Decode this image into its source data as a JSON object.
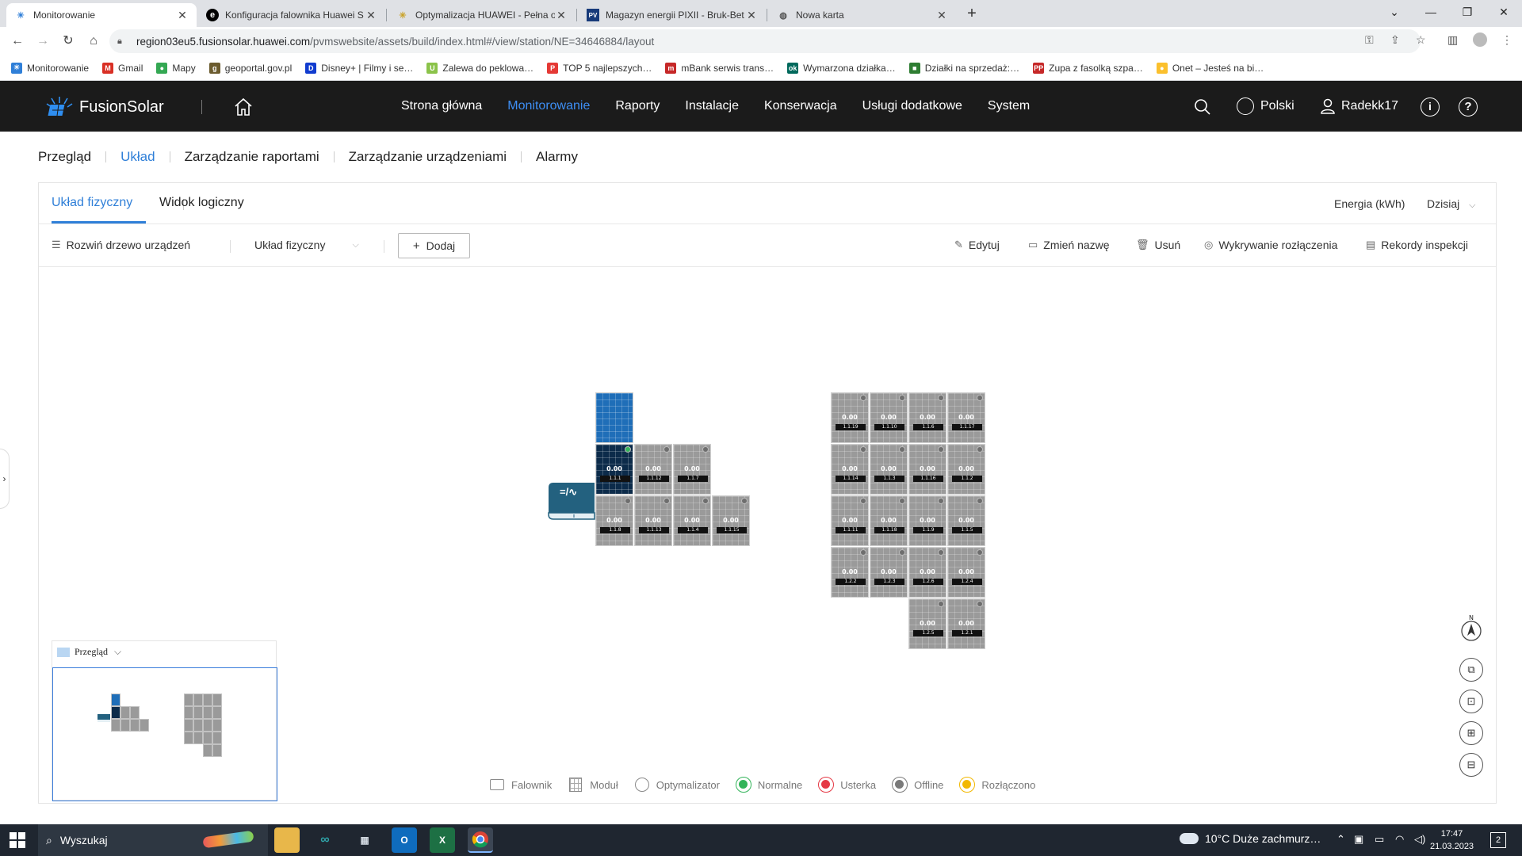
{
  "browser": {
    "tabs": [
      {
        "title": "Monitorowanie",
        "active": true
      },
      {
        "title": "Konfiguracja falownika Huawei S…",
        "active": false
      },
      {
        "title": "Optymalizacja HUAWEI - Pełna o…",
        "active": false
      },
      {
        "title": "Magazyn energii PIXII - Bruk-Bet…",
        "active": false
      },
      {
        "title": "Nowa karta",
        "active": false
      }
    ],
    "new_tab": "+",
    "window_controls": {
      "minimize": "—",
      "maximize": "❐",
      "close": "✕",
      "chevron": "⌄"
    },
    "url_host": "region03eu5.fusionsolar.huawei.com",
    "url_path": "/pvmswebsite/assets/build/index.html#/view/station/NE=34646884/layout",
    "bookmarks": [
      {
        "label": "Monitorowanie",
        "color": "#2f7fd8",
        "glyph": "☀"
      },
      {
        "label": "Gmail",
        "color": "#d93025",
        "glyph": "M"
      },
      {
        "label": "Mapy",
        "color": "#34a853",
        "glyph": "●"
      },
      {
        "label": "geoportal.gov.pl",
        "color": "#6b5b2e",
        "glyph": "g"
      },
      {
        "label": "Disney+ | Filmy i se…",
        "color": "#113ccf",
        "glyph": "D"
      },
      {
        "label": "Zalewa do peklowa…",
        "color": "#8bc34a",
        "glyph": "U"
      },
      {
        "label": "TOP 5 najlepszych…",
        "color": "#e53935",
        "glyph": "P"
      },
      {
        "label": "mBank serwis trans…",
        "color": "#c62828",
        "glyph": "m"
      },
      {
        "label": "Wymarzona działka…",
        "color": "#00695c",
        "glyph": "ok"
      },
      {
        "label": "Działki na sprzedaż:…",
        "color": "#2e7d32",
        "glyph": "■"
      },
      {
        "label": "Zupa z fasolką szpa…",
        "color": "#c62828",
        "glyph": "PP"
      },
      {
        "label": "Onet – Jesteś na bi…",
        "color": "#fbc02d",
        "glyph": "●"
      }
    ]
  },
  "app": {
    "brand": "FusionSolar",
    "nav": [
      {
        "label": "Strona główna",
        "active": false
      },
      {
        "label": "Monitorowanie",
        "active": true
      },
      {
        "label": "Raporty",
        "active": false
      },
      {
        "label": "Instalacje",
        "active": false
      },
      {
        "label": "Konserwacja",
        "active": false
      },
      {
        "label": "Usługi dodatkowe",
        "active": false
      },
      {
        "label": "System",
        "active": false
      }
    ],
    "language": "Polski",
    "user": "Radekk17"
  },
  "subnav": [
    {
      "label": "Przegląd",
      "active": false
    },
    {
      "label": "Układ",
      "active": true
    },
    {
      "label": "Zarządzanie raportami",
      "active": false
    },
    {
      "label": "Zarządzanie urządzeniami",
      "active": false
    },
    {
      "label": "Alarmy",
      "active": false
    }
  ],
  "view_tabs": {
    "physical": "Układ fizyczny",
    "logical": "Widok logiczny"
  },
  "energy_label": "Energia (kWh)",
  "period": "Dzisiaj",
  "actions": {
    "expand_tree": "Rozwiń drzewo urządzeń",
    "layout_select": "Układ fizyczny",
    "add": "Dodaj",
    "edit": "Edytuj",
    "rename": "Zmień nazwę",
    "delete": "Usuń",
    "detect": "Wykrywanie rozłączenia",
    "inspections": "Rekordy inspekcji"
  },
  "inverter_symbol": "=/∿",
  "panels_group1": [
    {
      "label": "",
      "value": "",
      "color": "blue",
      "status": "none"
    },
    {
      "label": "1.1.1",
      "value": "0.00",
      "color": "dark",
      "status": "ok"
    },
    {
      "label": "1.1.12",
      "value": "0.00",
      "color": "grey",
      "status": "offline"
    },
    {
      "label": "1.1.7",
      "value": "0.00",
      "color": "grey",
      "status": "offline"
    },
    {
      "label": "1.1.8",
      "value": "0.00",
      "color": "grey",
      "status": "offline"
    },
    {
      "label": "1.1.13",
      "value": "0.00",
      "color": "grey",
      "status": "offline"
    },
    {
      "label": "1.1.4",
      "value": "0.00",
      "color": "grey",
      "status": "offline"
    },
    {
      "label": "1.1.15",
      "value": "0.00",
      "color": "grey",
      "status": "offline"
    }
  ],
  "panels_group2": [
    {
      "label": "1.1.19",
      "value": "0.00"
    },
    {
      "label": "1.1.10",
      "value": "0.00"
    },
    {
      "label": "1.1.6",
      "value": "0.00"
    },
    {
      "label": "1.1.17",
      "value": "0.00"
    },
    {
      "label": "1.1.14",
      "value": "0.00"
    },
    {
      "label": "1.1.3",
      "value": "0.00"
    },
    {
      "label": "1.1.16",
      "value": "0.00"
    },
    {
      "label": "1.1.2",
      "value": "0.00"
    },
    {
      "label": "1.1.11",
      "value": "0.00"
    },
    {
      "label": "1.1.18",
      "value": "0.00"
    },
    {
      "label": "1.1.9",
      "value": "0.00"
    },
    {
      "label": "1.1.5",
      "value": "0.00"
    },
    {
      "label": "1.2.2",
      "value": "0.00"
    },
    {
      "label": "1.2.3",
      "value": "0.00"
    },
    {
      "label": "1.2.6",
      "value": "0.00"
    },
    {
      "label": "1.2.4",
      "value": "0.00"
    },
    {
      "label": "1.2.5",
      "value": "0.00"
    },
    {
      "label": "1.2.1",
      "value": "0.00"
    }
  ],
  "overview": {
    "label": "Przegląd"
  },
  "legend": [
    {
      "label": "Falownik",
      "icon": "inverter-icon",
      "color": "#8a8a8a"
    },
    {
      "label": "Moduł",
      "icon": "module-icon",
      "color": "#8a8a8a"
    },
    {
      "label": "Optymalizator",
      "icon": "optimizer-icon",
      "color": "#8a8a8a"
    },
    {
      "label": "Normalne",
      "icon": "normal-status-icon",
      "color": "#33b45a"
    },
    {
      "label": "Usterka",
      "icon": "fault-status-icon",
      "color": "#e53945"
    },
    {
      "label": "Offline",
      "icon": "offline-status-icon",
      "color": "#7a7a7a"
    },
    {
      "label": "Rozłączono",
      "icon": "disconnected-status-icon",
      "color": "#f2b800"
    }
  ],
  "taskbar": {
    "search": "Wyszukaj",
    "weather": "10°C  Duże zachmurz…",
    "time": "17:47",
    "date": "21.03.2023",
    "notifications": "2"
  }
}
